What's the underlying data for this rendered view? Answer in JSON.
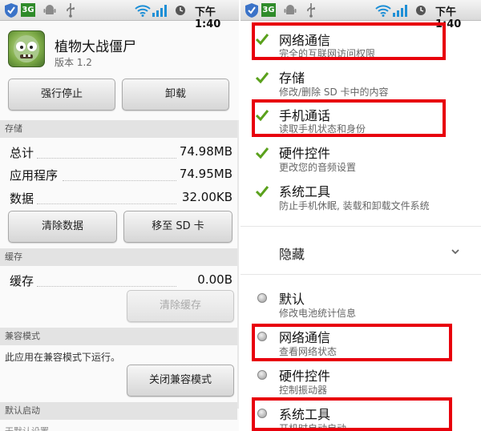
{
  "status_bar": {
    "time": "下午1:40",
    "network_badge": "3G",
    "icons": [
      "shield-check-icon",
      "3g-icon",
      "android-icon",
      "usb-icon",
      "wifi-icon",
      "signal-icon",
      "clock-icon"
    ]
  },
  "app_info": {
    "app_name": "植物大战僵尸",
    "version": "版本 1.2",
    "force_stop_label": "强行停止",
    "uninstall_label": "卸载",
    "storage": {
      "header": "存储",
      "rows": [
        {
          "label": "总计",
          "value": "74.98MB"
        },
        {
          "label": "应用程序",
          "value": "74.95MB"
        },
        {
          "label": "数据",
          "value": "32.00KB"
        }
      ],
      "clear_data_label": "清除数据",
      "move_to_sd_label": "移至 SD 卡"
    },
    "cache": {
      "header": "缓存",
      "label": "缓存",
      "value": "0.00B",
      "clear_cache_label": "清除缓存"
    },
    "compat": {
      "header": "兼容模式",
      "text": "此应用在兼容模式下运行。",
      "button_label": "关闭兼容模式"
    },
    "default_launch": {
      "header": "默认启动",
      "truncated_text": "无默认设置"
    }
  },
  "permissions": {
    "granted": [
      {
        "title": "网络通信",
        "desc": "完全的互联网访问权限"
      },
      {
        "title": "存储",
        "desc": "修改/删除 SD 卡中的内容"
      },
      {
        "title": "手机通话",
        "desc": "读取手机状态和身份"
      },
      {
        "title": "硬件控件",
        "desc": "更改您的音频设置"
      },
      {
        "title": "系统工具",
        "desc": "防止手机休眠, 装载和卸载文件系统"
      }
    ],
    "hidden_label": "隐藏",
    "hidden_items": [
      {
        "title": "默认",
        "desc": "修改电池统计信息"
      },
      {
        "title": "网络通信",
        "desc": "查看网络状态"
      },
      {
        "title": "硬件控件",
        "desc": "控制振动器"
      },
      {
        "title": "系统工具",
        "desc": "开机时自动启动"
      }
    ]
  },
  "colors": {
    "highlight": "#e8000c",
    "check": "#5aa11c",
    "section_header_bg": "#e3e3e3"
  }
}
